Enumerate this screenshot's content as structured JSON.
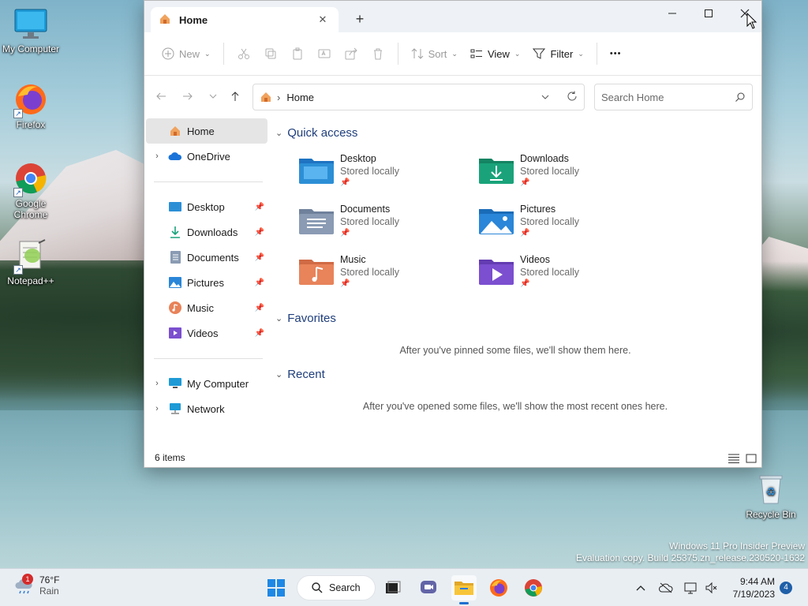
{
  "desktop": {
    "icons": [
      {
        "label": "My Computer",
        "icon": "monitor-icon"
      },
      {
        "label": "Firefox",
        "icon": "firefox-icon"
      },
      {
        "label": "Google Chrome",
        "icon": "chrome-icon"
      },
      {
        "label": "Notepad++",
        "icon": "notepadpp-icon"
      },
      {
        "label": "Recycle Bin",
        "icon": "recycle-bin-icon"
      }
    ],
    "watermark": {
      "line1": "Windows 11 Pro Insider Preview",
      "line2": "Evaluation copy. Build 25375.zn_release.230520-1632"
    }
  },
  "explorer": {
    "tab": {
      "title": "Home",
      "close": "✕",
      "new_tab": "+"
    },
    "window_controls": {
      "minimize": "—",
      "maximize": "☐",
      "close": "✕"
    },
    "toolbar": {
      "new_label": "New",
      "sort_label": "Sort",
      "view_label": "View",
      "filter_label": "Filter",
      "more_label": "•••"
    },
    "address": {
      "path_root": "›",
      "location": "Home"
    },
    "search": {
      "placeholder": "Search Home"
    },
    "sidebar": {
      "home": "Home",
      "onedrive": "OneDrive",
      "pinned": [
        {
          "label": "Desktop"
        },
        {
          "label": "Downloads"
        },
        {
          "label": "Documents"
        },
        {
          "label": "Pictures"
        },
        {
          "label": "Music"
        },
        {
          "label": "Videos"
        }
      ],
      "my_computer": "My Computer",
      "network": "Network"
    },
    "content": {
      "quick_access_title": "Quick access",
      "quick_access": [
        {
          "name": "Desktop",
          "sub": "Stored locally",
          "color": "#2c8fd6"
        },
        {
          "name": "Downloads",
          "sub": "Stored locally",
          "color": "#1aa37a"
        },
        {
          "name": "Documents",
          "sub": "Stored locally",
          "color": "#8a9bb3"
        },
        {
          "name": "Pictures",
          "sub": "Stored locally",
          "color": "#2a86d8"
        },
        {
          "name": "Music",
          "sub": "Stored locally",
          "color": "#e8835a"
        },
        {
          "name": "Videos",
          "sub": "Stored locally",
          "color": "#7b4fcf"
        }
      ],
      "favorites_title": "Favorites",
      "favorites_empty": "After you've pinned some files, we'll show them here.",
      "recent_title": "Recent",
      "recent_empty": "After you've opened some files, we'll show the most recent ones here."
    },
    "status": {
      "items_count": "6 items"
    }
  },
  "taskbar": {
    "weather": {
      "temp": "76°F",
      "condition": "Rain",
      "badge": "1"
    },
    "search_label": "Search",
    "clock": {
      "time": "9:44 AM",
      "date": "7/19/2023"
    },
    "notifications": "4"
  }
}
